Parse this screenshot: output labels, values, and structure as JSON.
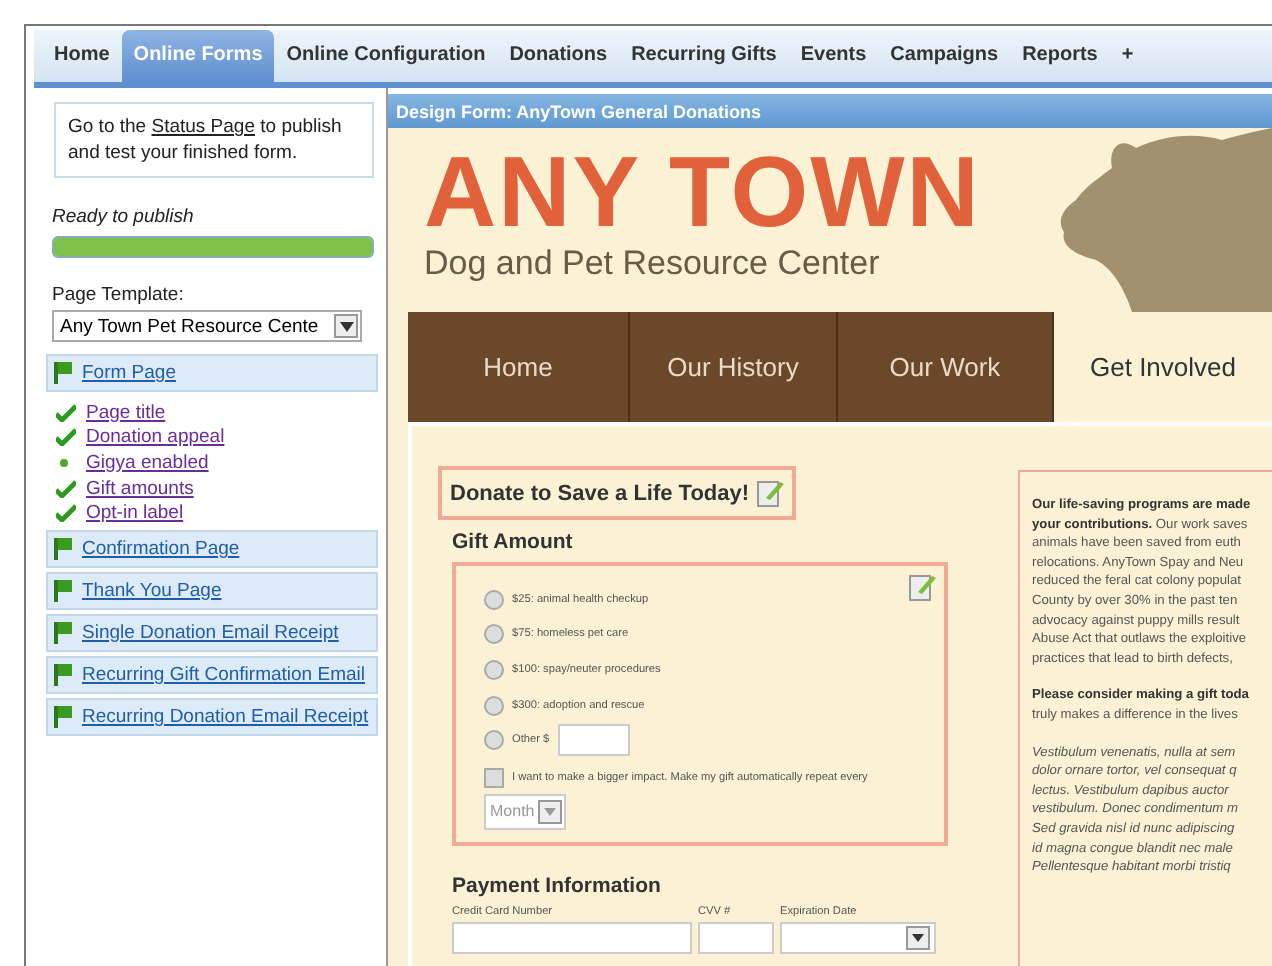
{
  "top_tabs": [
    {
      "label": "Home",
      "selected": false
    },
    {
      "label": "Online Forms",
      "selected": true
    },
    {
      "label": "Online Configuration",
      "selected": false
    },
    {
      "label": "Donations",
      "selected": false
    },
    {
      "label": "Recurring Gifts",
      "selected": false
    },
    {
      "label": "Events",
      "selected": false
    },
    {
      "label": "Campaigns",
      "selected": false
    },
    {
      "label": "Reports",
      "selected": false
    },
    {
      "label": "+",
      "selected": false
    }
  ],
  "sidebar": {
    "notice": {
      "before": "Go to the ",
      "link": "Status Page",
      "after": " to publish and test your finished form."
    },
    "status": {
      "label": "Ready to publish",
      "level": 1
    },
    "template": {
      "label": "Page Template:",
      "value": "Any Town Pet Resource Cente"
    },
    "sections": [
      {
        "label": "Form Page",
        "children": [
          {
            "label": "Page title",
            "checked": true
          },
          {
            "label": "Donation appeal",
            "checked": true
          },
          {
            "label": "Gigya enabled",
            "checked": false
          },
          {
            "label": "Gift amounts",
            "checked": true
          },
          {
            "label": "Opt-in label",
            "checked": true
          }
        ]
      },
      {
        "label": "Confirmation Page"
      },
      {
        "label": "Thank You Page"
      },
      {
        "label": "Single Donation Email Receipt"
      },
      {
        "label": "Recurring Gift Confirmation Email"
      },
      {
        "label": "Recurring Donation Email Receipt"
      }
    ]
  },
  "panel": {
    "title": "Design Form: AnyTown General Donations",
    "site": {
      "logo": "ANY TOWN",
      "tagline": "Dog and Pet Resource Center",
      "nav": [
        {
          "label": "Home",
          "selected": false
        },
        {
          "label": "Our History",
          "selected": false
        },
        {
          "label": "Our Work",
          "selected": false
        },
        {
          "label": "Get Involved",
          "selected": true
        }
      ]
    },
    "form": {
      "heading": "Donate to Save a Life Today!",
      "gift_title": "Gift Amount",
      "options": [
        {
          "label": "$25: animal health checkup",
          "selected": false
        },
        {
          "label": "$75: homeless pet care",
          "selected": false
        },
        {
          "label": "$100: spay/neuter procedures",
          "selected": false
        },
        {
          "label": "$300: adoption and rescue",
          "selected": false
        }
      ],
      "other": {
        "label": "Other $",
        "selected": false
      },
      "recurring": {
        "label": "I want to make a bigger impact. Make my gift automatically repeat every",
        "checked": false
      },
      "frequency": "Month",
      "payment_title": "Payment Information",
      "payment_fields": [
        {
          "label": "Credit Card Number",
          "kind": "text"
        },
        {
          "label": "CVV #",
          "kind": "text"
        },
        {
          "label": "Expiration Date",
          "kind": "select"
        }
      ]
    },
    "appeal": [
      [
        "**Our life-saving programs are made**",
        "**your contributions.** Our work saves",
        "animals have been saved from euth",
        "relocations. AnyTown Spay and Neu",
        "reduced the feral cat colony populat",
        "County by over 30% in the past ten",
        "advocacy against puppy mills result",
        "Abuse Act that outlaws the exploitive",
        "practices that lead to birth defects,"
      ],
      [
        "**Please consider making a gift toda**",
        "truly makes a difference in the lives"
      ],
      [
        "*Vestibulum venenatis, nulla at sem*",
        "*dolor ornare tortor, vel consequat q*",
        "*lectus. Vestibulum dapibus auctor*",
        "*vestibulum. Donec condimentum m*",
        "*Sed gravida nisl id nunc adipiscing*",
        "*id magna congue blandit nec male*",
        "*Pellentesque habitant morbi tristiq*"
      ]
    ]
  }
}
